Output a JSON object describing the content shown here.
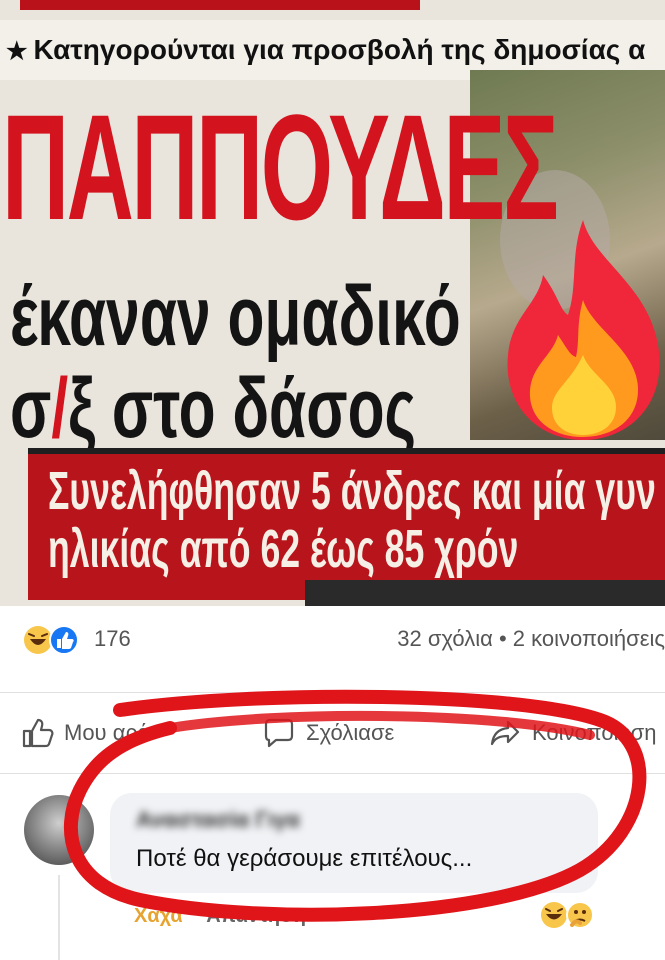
{
  "image": {
    "kicker": "Κατηγορούνται για προσβολή της δημοσίας α",
    "headline": "ΠΑΠΠΟΥΔΕΣ",
    "subline_1": "έκαναν ομαδικό",
    "subline_2_start": "σ",
    "subline_2_mark": "/",
    "subline_2_rest": "ξ στο δάσος",
    "banner_line_1": "Συνελήφθησαν 5 άνδρες και μία γυν",
    "banner_line_2": "ηλικίας από 62 έως 85 χρόν",
    "overlay_icon": "fire-emoji-icon"
  },
  "reactions": {
    "icons": [
      "haha-emoji-icon",
      "like-emoji-icon"
    ],
    "count": "176",
    "comments_shares": "32 σχόλια • 2 κοινοποιήσεις"
  },
  "actions": {
    "like_label": "Μου αρέ",
    "comment_label": "Σχόλιασε",
    "share_label": "Κοινοποίηση"
  },
  "comment": {
    "author": "Αναστασία Γιγα",
    "text": "Ποτέ θα γεράσουμε επιτέλους...",
    "haha_label": "Χαχα",
    "reply_label": "Απάντηση",
    "reaction_icons": [
      "haha-emoji-icon",
      "thinking-emoji-icon"
    ]
  },
  "colors": {
    "headline_red": "#d3141f",
    "circle_red": "#e0151a",
    "haha_orange": "#e7a32f",
    "like_blue": "#1877f2"
  }
}
